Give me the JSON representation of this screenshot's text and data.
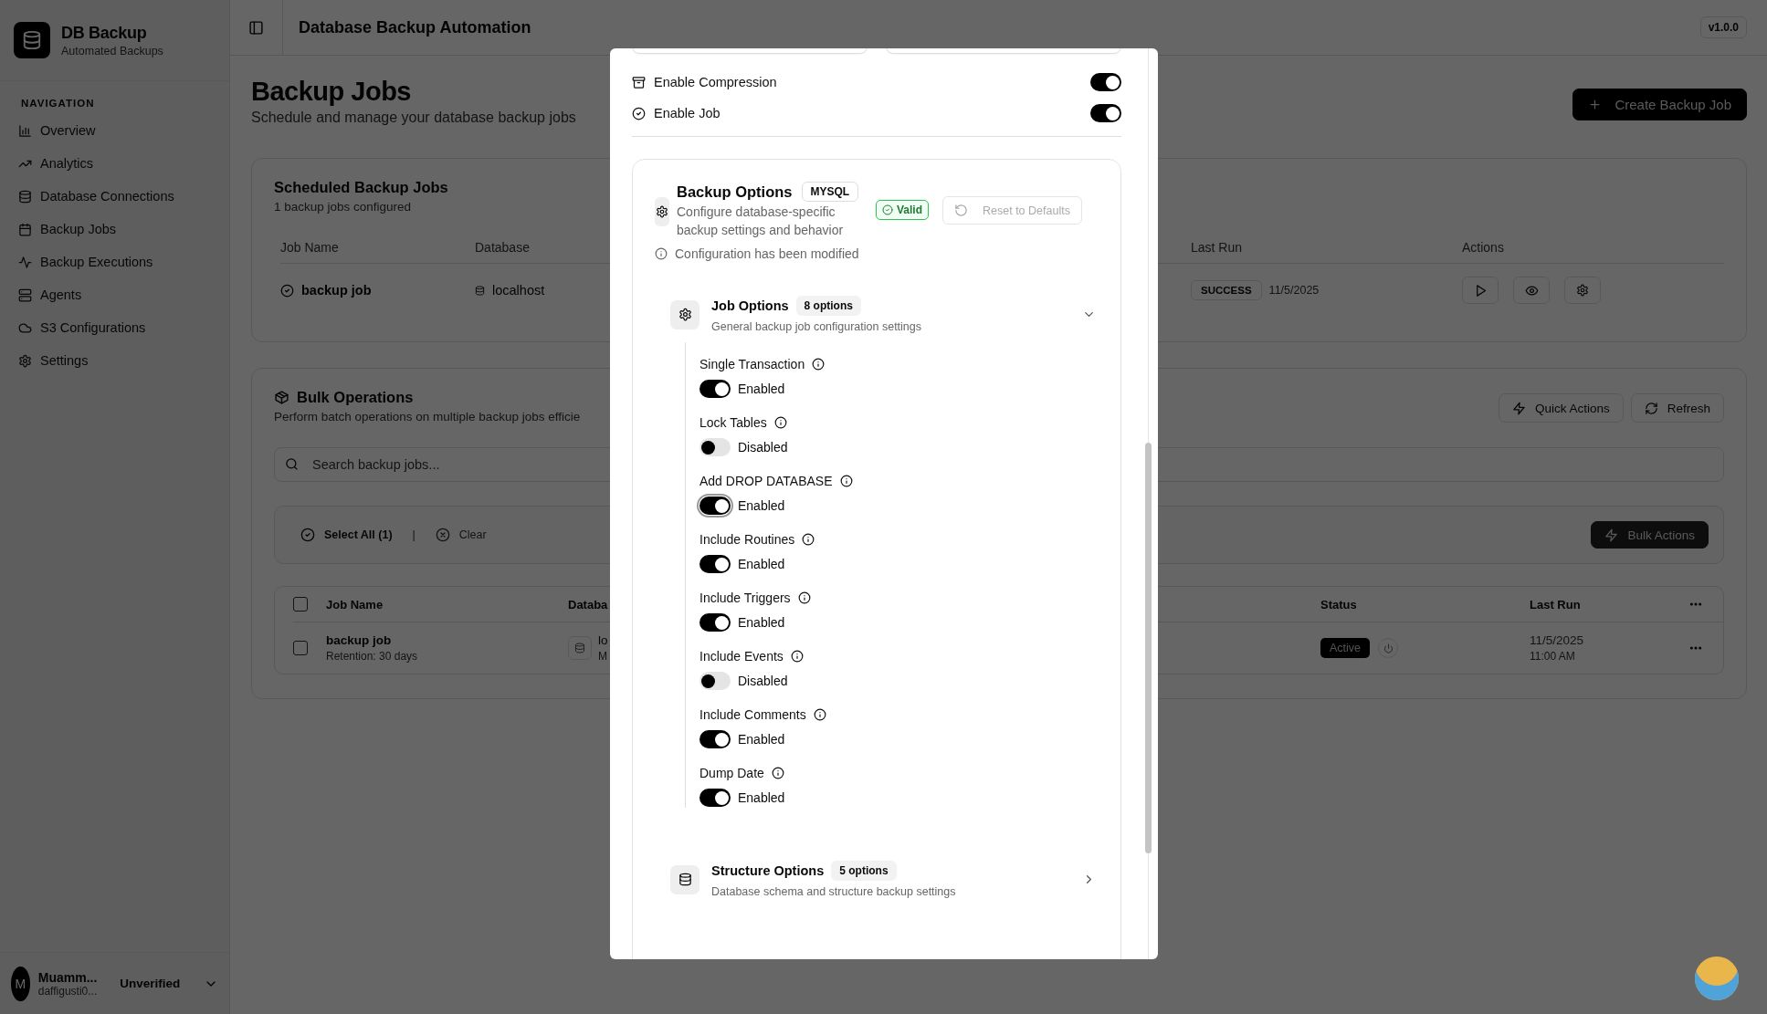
{
  "sidebar": {
    "app_name": "DB Backup",
    "app_subtitle": "Automated Backups",
    "section_label": "NAVIGATION",
    "items": [
      {
        "label": "Overview"
      },
      {
        "label": "Analytics"
      },
      {
        "label": "Database Connections"
      },
      {
        "label": "Backup Jobs"
      },
      {
        "label": "Backup Executions"
      },
      {
        "label": "Agents"
      },
      {
        "label": "S3 Configurations"
      },
      {
        "label": "Settings"
      }
    ],
    "user": {
      "initial": "M",
      "name": "Muamm...",
      "email": "daffigusti0...",
      "status": "Unverified"
    }
  },
  "header": {
    "title": "Database Backup Automation",
    "version": "v1.0.0"
  },
  "page": {
    "title": "Backup Jobs",
    "subtitle": "Schedule and manage your database backup jobs",
    "create_button": "Create Backup Job"
  },
  "scheduled_jobs": {
    "title": "Scheduled Backup Jobs",
    "subtitle": "1 backup jobs configured",
    "columns": [
      "Job Name",
      "Database",
      "Last Run",
      "Actions"
    ],
    "rows": [
      {
        "job_name": "backup job",
        "database": "localhost",
        "last_run_status": "SUCCESS",
        "last_run_date": "11/5/2025"
      }
    ]
  },
  "bulk_operations": {
    "title": "Bulk Operations",
    "description": "Perform batch operations on multiple backup jobs efficie",
    "quick_actions_button": "Quick Actions",
    "refresh_button": "Refresh",
    "search": {
      "placeholder": "Search backup jobs..."
    },
    "select_all": "Select All (1)",
    "separator": "|",
    "clear": "Clear",
    "bulk_actions_button": "Bulk Actions",
    "header_checked": false,
    "columns": [
      "Job Name",
      "Databa",
      "Status",
      "Last Run"
    ],
    "rows": [
      {
        "checked": false,
        "job_name": "backup job",
        "retention": "Retention: 30 days",
        "database": "lo",
        "database_detail": "M",
        "status": "Active",
        "last_run_date": "11/5/2025",
        "last_run_time": "11:00 AM"
      }
    ]
  },
  "modal": {
    "toggles": [
      {
        "label": "Enable Compression",
        "on": true
      },
      {
        "label": "Enable Job",
        "on": true
      }
    ],
    "backup_options": {
      "title": "Backup Options",
      "engine": "MYSQL",
      "description": "Configure database-specific backup settings and behavior",
      "validation": {
        "label": "Valid",
        "valid": true
      },
      "reset_button": {
        "label": "Reset to Defaults",
        "disabled": true
      },
      "notice": "Configuration has been modified",
      "sections": [
        {
          "title": "Job Options",
          "count": "8 options",
          "description": "General backup job configuration settings",
          "expanded": true,
          "options": [
            {
              "label": "Single Transaction",
              "on": true,
              "state_label": "Enabled"
            },
            {
              "label": "Lock Tables",
              "on": false,
              "state_label": "Disabled"
            },
            {
              "label": "Add DROP DATABASE",
              "on": true,
              "state_label": "Enabled",
              "focused": true
            },
            {
              "label": "Include Routines",
              "on": true,
              "state_label": "Enabled"
            },
            {
              "label": "Include Triggers",
              "on": true,
              "state_label": "Enabled"
            },
            {
              "label": "Include Events",
              "on": false,
              "state_label": "Disabled"
            },
            {
              "label": "Include Comments",
              "on": true,
              "state_label": "Enabled"
            },
            {
              "label": "Dump Date",
              "on": true,
              "state_label": "Enabled"
            }
          ]
        },
        {
          "title": "Structure Options",
          "count": "5 options",
          "description": "Database schema and structure backup settings",
          "expanded": false
        }
      ]
    }
  }
}
